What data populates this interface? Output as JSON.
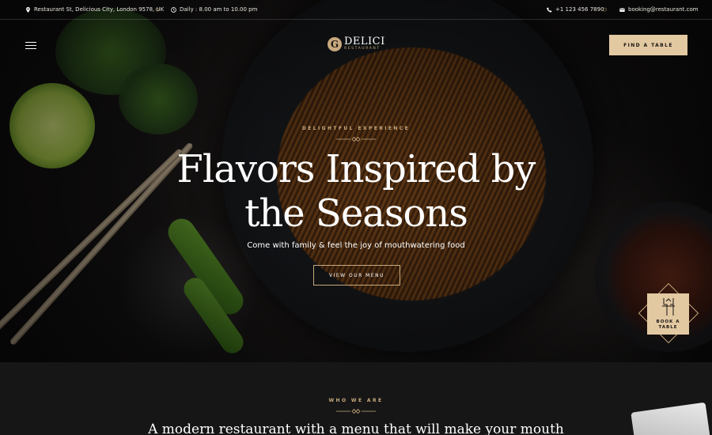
{
  "topbar": {
    "address": "Restaurant St, Delicious City, London 9578, UK",
    "hours": "Daily : 8.00 am to 10.00 pm",
    "phone": "+1 123 456 7890",
    "email": "booking@restaurant.com"
  },
  "header": {
    "logo_name": "DELICI",
    "logo_sub": "RESTAURANT",
    "logo_mark": "G",
    "cta_label": "FIND A TABLE"
  },
  "hero": {
    "eyebrow": "DELIGHTFUL EXPERIENCE",
    "title_line1": "Flavors Inspired by",
    "title_line2": "the Seasons",
    "subtitle": "Come with family & feel the joy of mouthwatering food",
    "button_label": "VIEW OUR MENU"
  },
  "book_table": {
    "line1": "BOOK A",
    "line2": "TABLE"
  },
  "about": {
    "eyebrow": "WHO WE ARE",
    "title": "A modern restaurant with a menu that will make your mouth"
  },
  "colors": {
    "accent": "#c8a97e",
    "button_fill": "#e2c9a2",
    "background": "#0e0d0d",
    "section_bg": "#161616"
  },
  "icons": {
    "address": "location-pin-icon",
    "hours": "clock-icon",
    "phone": "phone-icon",
    "email": "envelope-icon",
    "menu": "hamburger-icon"
  }
}
